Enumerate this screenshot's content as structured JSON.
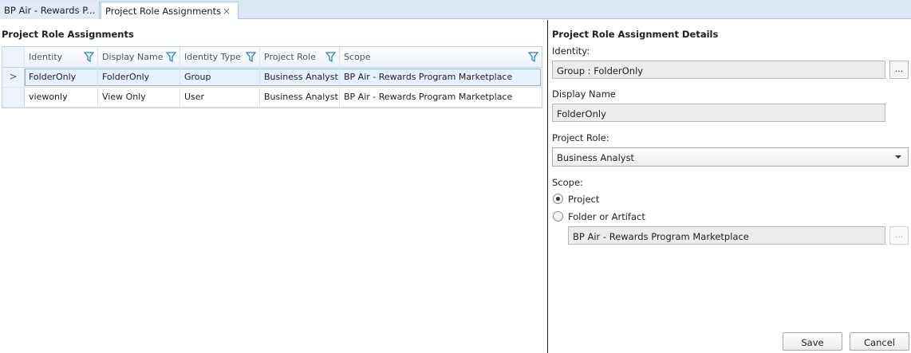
{
  "tabs": [
    {
      "label": "BP Air - Rewards P...",
      "active": false
    },
    {
      "label": "Project Role Assignments",
      "active": true,
      "close": "×"
    }
  ],
  "left": {
    "title": "Project Role Assignments",
    "columns": [
      "Identity",
      "Display Name",
      "Identity Type",
      "Project Role",
      "Scope"
    ],
    "rows": [
      {
        "indicator": ">",
        "identity": "FolderOnly",
        "display_name": "FolderOnly",
        "identity_type": "Group",
        "project_role": "Business Analyst",
        "scope": "BP Air - Rewards Program Marketplace",
        "selected": true
      },
      {
        "indicator": "",
        "identity": "viewonly",
        "display_name": "View Only",
        "identity_type": "User",
        "project_role": "Business Analyst",
        "scope": "BP Air - Rewards Program Marketplace",
        "selected": false
      }
    ]
  },
  "details": {
    "title": "Project Role Assignment Details",
    "identity_label": "Identity:",
    "identity_value": "Group : FolderOnly",
    "ellipsis": "...",
    "display_name_label": "Display Name",
    "display_name_value": "FolderOnly",
    "project_role_label": "Project Role:",
    "project_role_value": "Business Analyst",
    "scope_label": "Scope:",
    "scope_options": [
      {
        "label": "Project",
        "checked": true
      },
      {
        "label": "Folder or Artifact",
        "checked": false
      }
    ],
    "folder_value": "BP Air - Rewards Program Marketplace",
    "save_label": "Save",
    "cancel_label": "Cancel"
  },
  "colors": {
    "accent": "#2f7fd0",
    "tabstrip": "#dde7f3",
    "selected_row": "#e8f1fb"
  }
}
